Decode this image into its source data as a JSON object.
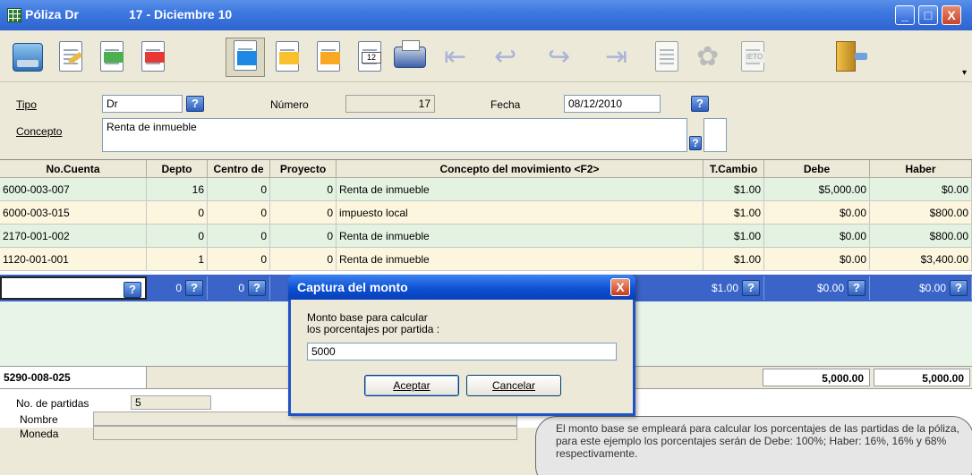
{
  "window": {
    "title": "Póliza Dr",
    "subtitle": "17 - Diciembre 10",
    "min": "_",
    "max": "□",
    "close": "X"
  },
  "toolbar": {
    "icons": [
      "save-icon",
      "edit-icon",
      "add-row-icon",
      "delete-row-icon",
      "capture-icon",
      "mail-icon",
      "folder-icon",
      "calendar-icon",
      "print-icon",
      "first-icon",
      "previous-icon",
      "next-icon",
      "last-icon",
      "columns-icon",
      "distribute-icon",
      "ieto-icon",
      "exit-icon"
    ],
    "calendar_day": "12",
    "ieto_label": "IETO"
  },
  "header": {
    "tipo_label": "Tipo",
    "tipo_value": "Dr",
    "numero_label": "Número",
    "numero_value": "17",
    "fecha_label": "Fecha",
    "fecha_value": "08/12/2010",
    "concepto_label": "Concepto",
    "concepto_value": "Renta de inmueble",
    "help": "?"
  },
  "grid": {
    "columns": [
      "No.Cuenta",
      "Depto",
      "Centro de",
      "Proyecto",
      "Concepto del movimiento <F2>",
      "T.Cambio",
      "Debe",
      "Haber"
    ],
    "rows": [
      {
        "cuenta": "6000-003-007",
        "depto": "16",
        "centro": "0",
        "proyecto": "0",
        "concepto": "Renta de inmueble",
        "tcambio": "$1.00",
        "debe": "$5,000.00",
        "haber": "$0.00"
      },
      {
        "cuenta": "6000-003-015",
        "depto": "0",
        "centro": "0",
        "proyecto": "0",
        "concepto": "impuesto local",
        "tcambio": "$1.00",
        "debe": "$0.00",
        "haber": "$800.00"
      },
      {
        "cuenta": "2170-001-002",
        "depto": "0",
        "centro": "0",
        "proyecto": "0",
        "concepto": "Renta de inmueble",
        "tcambio": "$1.00",
        "debe": "$0.00",
        "haber": "$800.00"
      },
      {
        "cuenta": "1120-001-001",
        "depto": "1",
        "centro": "0",
        "proyecto": "0",
        "concepto": "Renta de inmueble",
        "tcambio": "$1.00",
        "debe": "$0.00",
        "haber": "$3,400.00"
      }
    ],
    "new_row": {
      "depto": "0",
      "centro": "0",
      "tcambio": "$1.00",
      "debe": "$0.00",
      "haber": "$0.00"
    },
    "totals": {
      "cuenta": "5290-008-025",
      "debe": "5,000.00",
      "haber": "5,000.00"
    }
  },
  "footer": {
    "partidas_label": "No. de partidas",
    "partidas_value": "5",
    "nombre_label": "Nombre",
    "moneda_label": "Moneda"
  },
  "dialog": {
    "title": "Captura del monto",
    "close": "X",
    "text_line1": "Monto base para calcular",
    "text_line2": "los porcentajes por partida :",
    "input_value": "5000",
    "ok_label": "Aceptar",
    "cancel_label": "Cancelar"
  },
  "callout": {
    "text": "El monto base se empleará para calcular los porcentajes de las partidas de la póliza, para este ejemplo los porcentajes serán de Debe: 100%; Haber: 16%, 16% y 68% respectivamente."
  },
  "colors": {
    "titlebar": "#2f64cf",
    "row_green": "#e4f2e2",
    "row_yellow": "#fdf6df",
    "selected_row": "#3a64c8"
  }
}
